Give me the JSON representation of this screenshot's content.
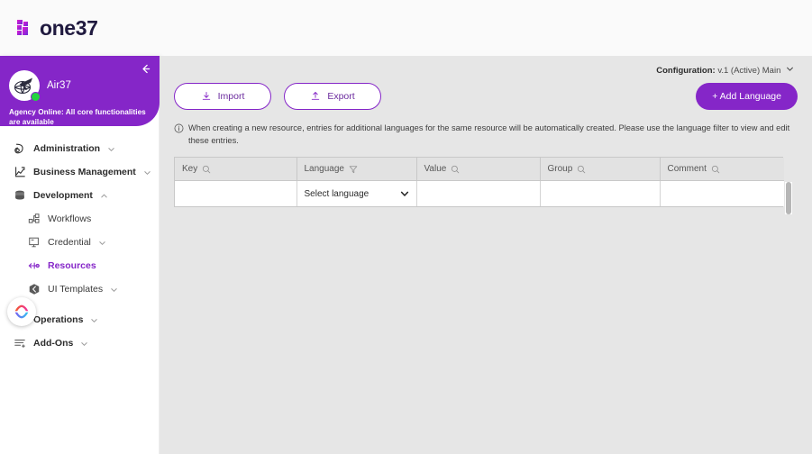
{
  "brand": {
    "name": "one37",
    "logo_icon": "one37-logo-icon"
  },
  "sidebar": {
    "collapse_icon": "arrow-left-icon",
    "profile": {
      "name": "Air37",
      "avatar_icon": "airplane-globe-avatar-icon",
      "presence": "online",
      "status_text": "Agency Online: All core functionalities are available"
    },
    "items": [
      {
        "label": "Administration",
        "icon": "administration-icon",
        "chevron": "chevron-down-icon",
        "active": false,
        "sub": false
      },
      {
        "label": "Business Management",
        "icon": "business-chart-icon",
        "chevron": "chevron-down-icon",
        "active": false,
        "sub": false
      },
      {
        "label": "Development",
        "icon": "database-stack-icon",
        "chevron": "chevron-up-icon",
        "active": false,
        "sub": false
      },
      {
        "label": "Workflows",
        "icon": "workflow-nodes-icon",
        "chevron": "",
        "active": false,
        "sub": true
      },
      {
        "label": "Credential",
        "icon": "credential-card-icon",
        "chevron": "chevron-down-icon",
        "active": false,
        "sub": true
      },
      {
        "label": "Resources",
        "icon": "resources-arrows-icon",
        "chevron": "",
        "active": true,
        "sub": true
      },
      {
        "label": "UI Templates",
        "icon": "ui-templates-cube-icon",
        "chevron": "chevron-down-icon",
        "active": false,
        "sub": true
      },
      {
        "label": "Operations",
        "icon": "operations-gear-icon",
        "chevron": "chevron-down-icon",
        "active": false,
        "sub": false
      },
      {
        "label": "Add-Ons",
        "icon": "add-ons-lines-icon",
        "chevron": "chevron-down-icon",
        "active": false,
        "sub": false
      }
    ],
    "assistant_bubble_icon": "assistant-gradient-icon"
  },
  "main": {
    "configuration": {
      "label": "Configuration:",
      "value": "v.1 (Active) Main",
      "caret_icon": "chevron-down-icon"
    },
    "toolbar": {
      "import_label": "Import",
      "import_icon": "download-icon",
      "export_label": "Export",
      "export_icon": "upload-icon",
      "add_language_label": "+ Add Language"
    },
    "info_note": {
      "icon": "info-circle-icon",
      "text": "When creating a new resource, entries for additional languages for the same resource will be automatically created. Please use the language filter to view and edit these entries."
    },
    "table": {
      "columns": [
        {
          "label": "Key",
          "icon": "search-icon"
        },
        {
          "label": "Language",
          "icon": "filter-icon"
        },
        {
          "label": "Value",
          "icon": "search-icon"
        },
        {
          "label": "Group",
          "icon": "search-icon"
        },
        {
          "label": "Comment",
          "icon": "search-icon"
        }
      ],
      "rows": [
        {
          "key": "",
          "language": "Select language",
          "language_caret_icon": "chevron-down-icon",
          "value": "",
          "group": "",
          "comment": ""
        }
      ],
      "scrollbar_icon": "vertical-scrollbar"
    }
  },
  "colors": {
    "brand_purple": "#8526c8",
    "page_background": "#e6e6e6",
    "sidebar_background": "#ffffff",
    "presence_green": "#24d33f",
    "logo_gradient_from": "#e31ad1",
    "logo_gradient_to": "#7a2bd4"
  }
}
